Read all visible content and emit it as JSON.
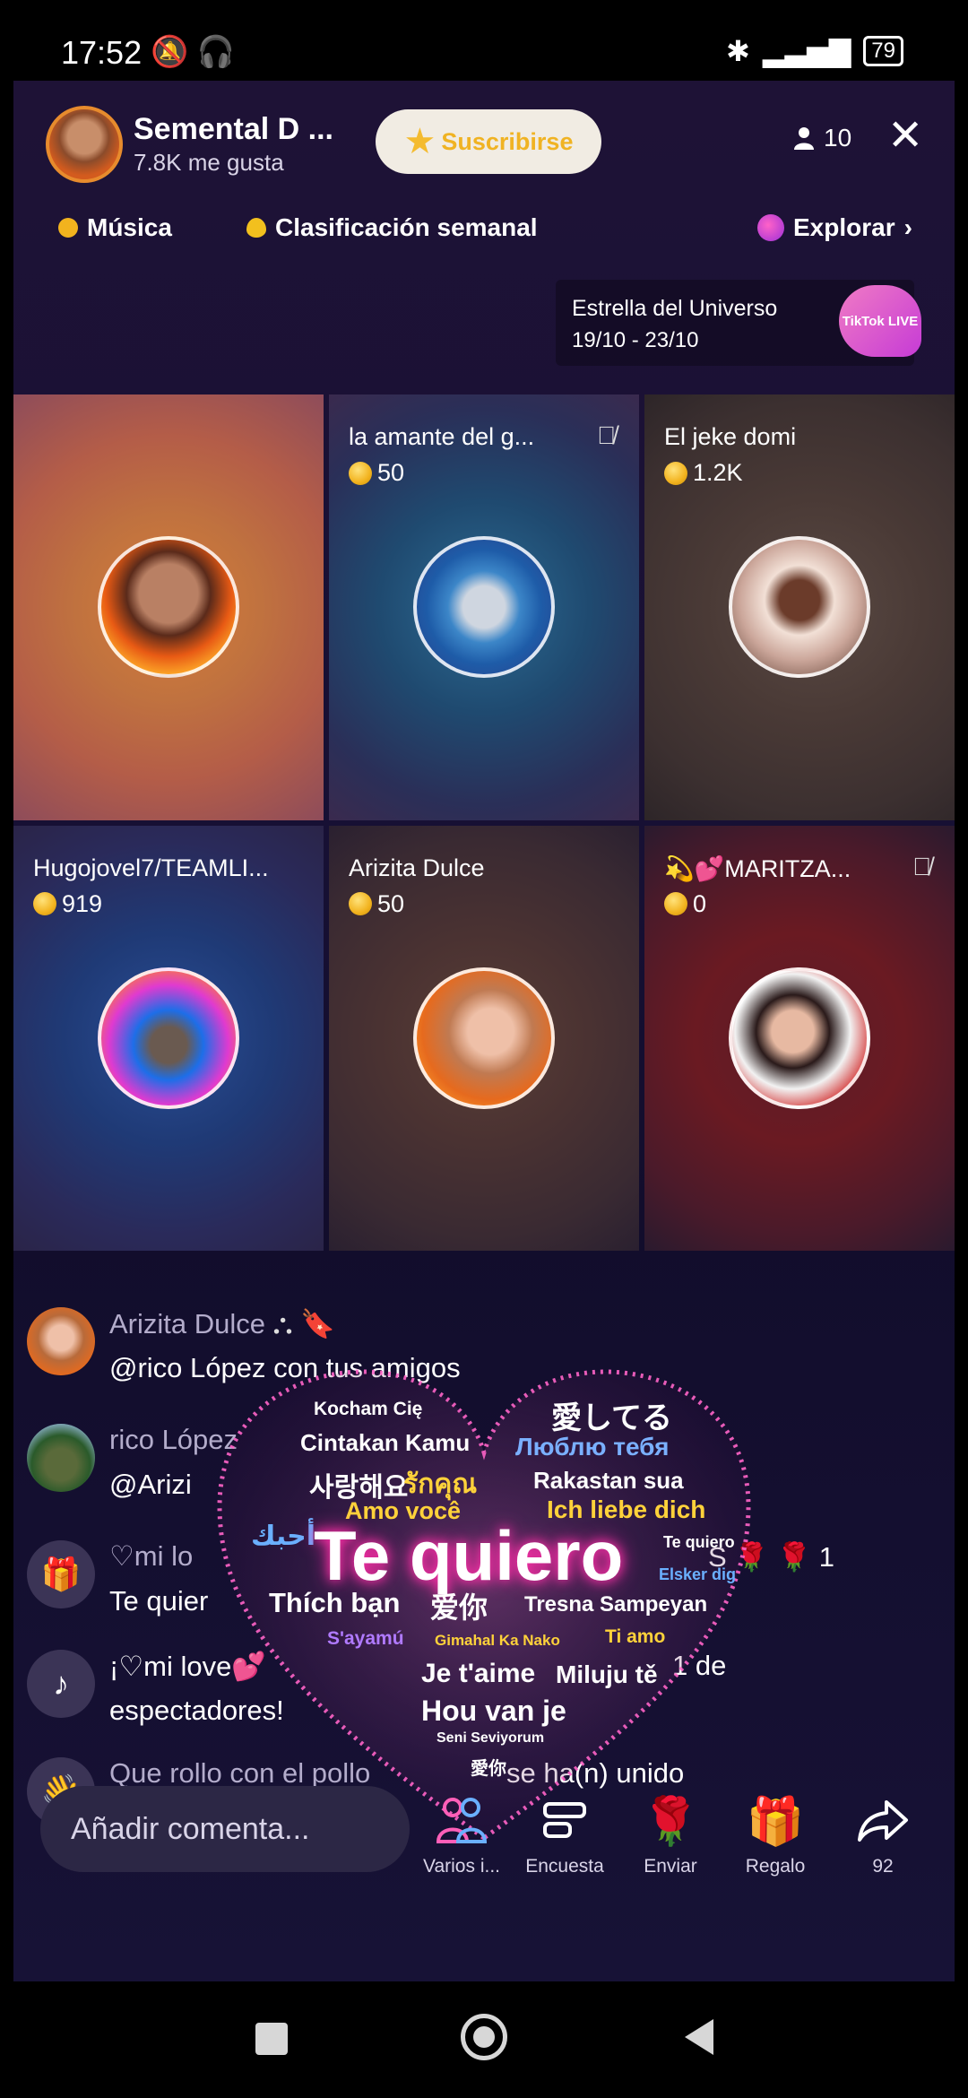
{
  "status_bar": {
    "time": "17:52",
    "battery": "79"
  },
  "host": {
    "name": "Semental D ...",
    "likes": "7.8K me gusta"
  },
  "subscribe_label": "Suscribirse",
  "viewer_count": "10",
  "nav": {
    "music": "Música",
    "ranking": "Clasificación semanal",
    "explore": "Explorar"
  },
  "event": {
    "title": "Estrella del Universo",
    "dates": "19/10 - 23/10",
    "badge": "TikTok LIVE"
  },
  "guests": [
    {
      "name": "",
      "coins": ""
    },
    {
      "name": "la amante del g...",
      "coins": "50"
    },
    {
      "name": "El jeke domi",
      "coins": "1.2K"
    },
    {
      "name": "Hugojovel7/TEAMLI...",
      "coins": "919"
    },
    {
      "name": "Arizita Dulce",
      "coins": "50"
    },
    {
      "name": "💫💕MARITZA...",
      "coins": "0"
    }
  ],
  "chat": [
    {
      "user": "Arizita Dulce",
      "text": "@rico López con tus amigos"
    },
    {
      "user": "rico López",
      "text": "@Arizi"
    },
    {
      "user": "♡mi lo",
      "text": "Te quier",
      "suffix": "S 🌹 🌹 1"
    },
    {
      "user": "",
      "text": "¡♡mi love💕",
      "text2": "espectadores!",
      "suffix": "1 de"
    },
    {
      "user": "",
      "text": "Que rollo con el pollo",
      "suffix": "se ha(n) unido"
    }
  ],
  "gift_overlay": {
    "center": "Te quiero",
    "words": [
      "Kocham Cię",
      "愛してる",
      "Cintakan Kamu",
      "Люблю тебя",
      "사랑해요",
      "รักคุณ",
      "Rakastan sua",
      "Amo você",
      "Ich liebe dich",
      "أحبك",
      "Thích bạn",
      "爱你",
      "Tresna Sampeyan",
      "S'ayamú",
      "Gimahal Ka Nako",
      "Ti amo",
      "Je t'aime",
      "Miluju tě",
      "Hou van je",
      "Seni Seviyorum",
      "愛你",
      "Elsker dig",
      "Te quiero"
    ]
  },
  "bottom": {
    "comment_placeholder": "Añadir comenta...",
    "actions": [
      "Varios i...",
      "Encuesta",
      "Enviar",
      "Regalo",
      "92"
    ]
  },
  "colors": {
    "background": "#171034",
    "accent_gold": "#f2b31e",
    "subscribe_bg": "#f1ece3",
    "pink_glow": "#ff2fa8"
  },
  "icons": [
    "mute-icon",
    "headset-icon",
    "bluetooth-icon",
    "signal-icon",
    "battery-icon",
    "star-icon",
    "person-icon",
    "close-icon",
    "coin-icon",
    "chevron-right-icon",
    "mic-off-icon",
    "gift-icon",
    "tiktok-icon",
    "wave-hand-icon",
    "multi-guest-icon",
    "poll-icon",
    "rose-icon",
    "share-icon"
  ]
}
